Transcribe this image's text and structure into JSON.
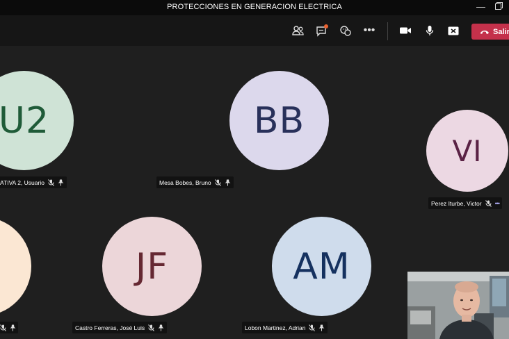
{
  "window": {
    "title": "PROTECCIONES EN GENERACION ELECTRICA"
  },
  "toolbar": {
    "leave_label": "Salir"
  },
  "participants": [
    {
      "initials": "U2",
      "name": "ATIVA 2, Usuario"
    },
    {
      "initials": "BB",
      "name": "Mesa Bobes, Bruno"
    },
    {
      "initials": "VI",
      "name": "Perez Iturbe, Victor"
    },
    {
      "initials": "JF",
      "name": "Castro Ferreras, José Luis"
    },
    {
      "initials": "AM",
      "name": "Lobon Martinez, Adrian"
    }
  ],
  "colors": {
    "leave": "#c4314b",
    "unread_dot": "#e9612f",
    "U2": "#cfe3d6",
    "U2_text": "#1f5b38",
    "BB": "#dcd8ec",
    "BB_text": "#28305a",
    "VI": "#ecd8e3",
    "VI_text": "#5a2245",
    "JF": "#ecd6d9",
    "JF_text": "#652832",
    "AM": "#cfdcec",
    "AM_text": "#15315f",
    "partial": "#fbe7d3"
  }
}
